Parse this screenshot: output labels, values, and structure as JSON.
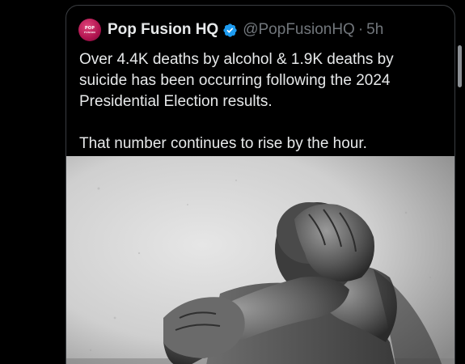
{
  "post": {
    "display_name": "Pop Fusion HQ",
    "handle": "@PopFusionHQ",
    "separator": "·",
    "time": "5h",
    "avatar_text_top": "POP",
    "avatar_text_bottom": "FUSION",
    "text_line1": "Over 4.4K deaths by alcohol & 1.9K deaths by suicide has been occurring following the 2024 Presidential Election results.",
    "text_line2": "That number continues to rise by the hour."
  },
  "colors": {
    "background": "#000000",
    "text_primary": "#e7e9ea",
    "text_secondary": "#71767b",
    "verified_badge": "#1d9bf0",
    "avatar_brand": "#c2185b",
    "card_border": "#3a3d41"
  },
  "icons": {
    "verified": "verified-badge-icon",
    "avatar": "pop-fusion-logo"
  },
  "media": {
    "kind": "black-and-white photo of a man covering his head with his hands"
  }
}
